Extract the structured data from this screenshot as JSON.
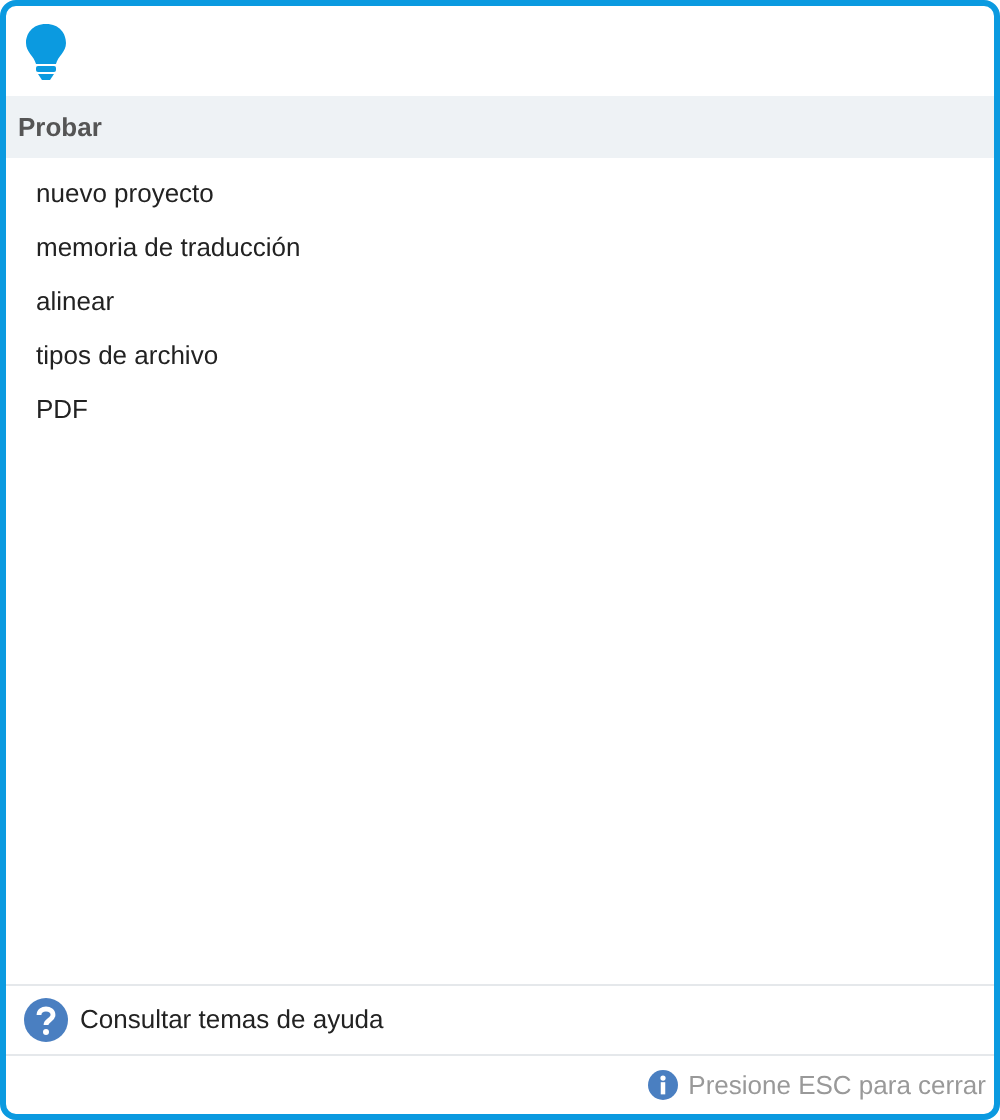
{
  "section": {
    "title": "Probar"
  },
  "items": [
    "nuevo proyecto",
    "memoria de traducción",
    "alinear",
    "tipos de archivo",
    "PDF"
  ],
  "help_link": "Consultar temas de ayuda",
  "footer": "Presione ESC para cerrar"
}
